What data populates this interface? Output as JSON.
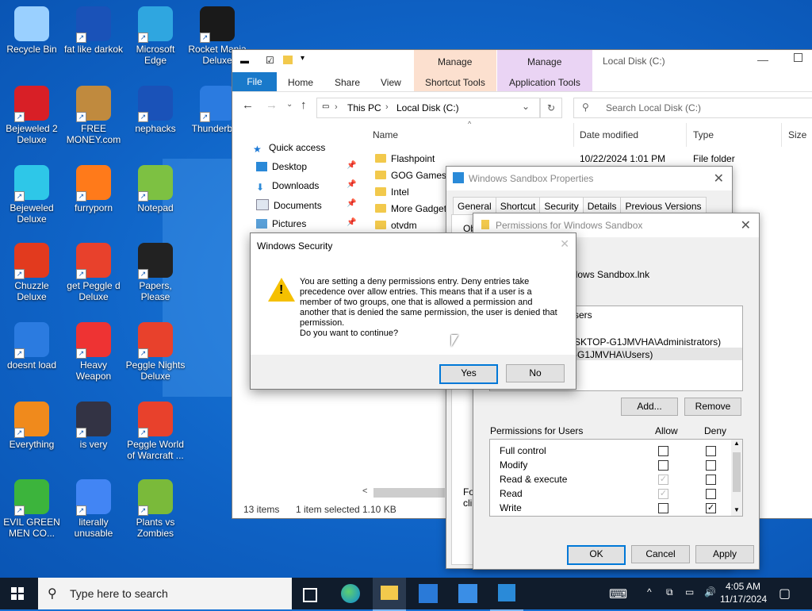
{
  "desktop_icons": [
    {
      "label": "Recycle Bin",
      "icon": "recycle-bin-icon",
      "color": "#9ad0ff"
    },
    {
      "label": "fat like darkok",
      "icon": "mpi-logo-icon",
      "color": "#1a52b8"
    },
    {
      "label": "Microsoft Edge",
      "icon": "edge-icon",
      "color": "#2fa6e0"
    },
    {
      "label": "Rocket Mania Deluxe",
      "icon": "rocket-icon",
      "color": "#1a1a1a"
    },
    {
      "label": "Bejeweled 2 Deluxe",
      "icon": "bejeweled-icon",
      "color": "#d81f26"
    },
    {
      "label": "FREE MONEY.com",
      "icon": "money-bag-icon",
      "color": "#c08a3e"
    },
    {
      "label": "nephacks",
      "icon": "mpi-logo-icon",
      "color": "#1a52b8"
    },
    {
      "label": "Thunderbird",
      "icon": "thunderbird-icon",
      "color": "#2b7be0"
    },
    {
      "label": "Bejeweled Deluxe",
      "icon": "gem-icon",
      "color": "#2ec7e8"
    },
    {
      "label": "furryporn",
      "icon": "firefox-icon",
      "color": "#ff7a1a"
    },
    {
      "label": "Notepad",
      "icon": "notepad-icon",
      "color": "#7dc142"
    },
    {
      "label": "Chuzzle Deluxe",
      "icon": "chuzzle-icon",
      "color": "#e23a1e"
    },
    {
      "label": "get Peggle d Deluxe",
      "icon": "peggle-icon",
      "color": "#e8412c"
    },
    {
      "label": "Papers, Please",
      "icon": "papers-icon",
      "color": "#222"
    },
    {
      "label": "doesnt load",
      "icon": "thunderbird-icon",
      "color": "#2b7be0"
    },
    {
      "label": "Heavy Weapon",
      "icon": "radiation-icon",
      "color": "#e33"
    },
    {
      "label": "Peggle Nights Deluxe",
      "icon": "peggle-icon",
      "color": "#e8412c"
    },
    {
      "label": "Everything",
      "icon": "search-lens-icon",
      "color": "#f08a1c"
    },
    {
      "label": "is very",
      "icon": "mpi-shield-icon",
      "color": "#334"
    },
    {
      "label": "Peggle World of Warcraft ...",
      "icon": "peggle-icon",
      "color": "#e8412c"
    },
    {
      "label": "EVIL GREEN MEN CO...",
      "icon": "msn-icon",
      "color": "#3cb43c"
    },
    {
      "label": "literally unusable",
      "icon": "chrome-icon",
      "color": "#4285f4"
    },
    {
      "label": "Plants vs Zombies",
      "icon": "pvz-icon",
      "color": "#7aba3a"
    }
  ],
  "explorer": {
    "manage1": "Manage",
    "manage2": "Manage",
    "title": "Local Disk (C:)",
    "tabs": {
      "file": "File",
      "home": "Home",
      "share": "Share",
      "view": "View",
      "shortcut_tools": "Shortcut Tools",
      "application_tools": "Application Tools"
    },
    "address": {
      "this_pc": "This PC",
      "local_disk": "Local Disk (C:)"
    },
    "search_placeholder": "Search Local Disk (C:)",
    "columns": {
      "name": "Name",
      "date": "Date modified",
      "type": "Type",
      "size": "Size"
    },
    "nav": {
      "quick_access": "Quick access",
      "desktop": "Desktop",
      "downloads": "Downloads",
      "documents": "Documents",
      "pictures": "Pictures"
    },
    "files": [
      "Flashpoint",
      "GOG Games",
      "Intel",
      "More Gadgets",
      "otvdm"
    ],
    "first_file_date": "10/22/2024 1:01 PM",
    "first_file_type": "File folder",
    "status": {
      "items": "13 items",
      "selected": "1 item selected",
      "size": "1.10 KB"
    },
    "frag_fo": "Fo",
    "frag_cli": "cli",
    "frag_ob": "Ob"
  },
  "props": {
    "title": "Windows Sandbox Properties",
    "tabs": [
      "General",
      "Shortcut",
      "Security",
      "Details",
      "Previous Versions"
    ]
  },
  "perms": {
    "title": "Permissions for Windows Sandbox",
    "object": "ndows Sandbox.lnk",
    "group_header": "sers",
    "groups": [
      "SKTOP-G1JMVHA\\Administrators)",
      "-G1JMVHA\\Users)"
    ],
    "add": "Add...",
    "remove": "Remove",
    "perm_header": "Permissions for Users",
    "allow": "Allow",
    "deny": "Deny",
    "rows": [
      {
        "name": "Full control",
        "allow": false,
        "deny": false,
        "allow_dis": false
      },
      {
        "name": "Modify",
        "allow": false,
        "deny": false,
        "allow_dis": false
      },
      {
        "name": "Read & execute",
        "allow": true,
        "deny": false,
        "allow_dis": true
      },
      {
        "name": "Read",
        "allow": true,
        "deny": false,
        "allow_dis": true
      },
      {
        "name": "Write",
        "allow": false,
        "deny": true,
        "allow_dis": false
      }
    ],
    "ok": "OK",
    "cancel": "Cancel",
    "apply": "Apply"
  },
  "security": {
    "title": "Windows Security",
    "message": "You are setting a deny permissions entry. Deny entries take precedence over allow entries. This means that if a user is a member of two groups, one that is allowed a permission and another that is denied the same permission, the user is denied that permission.",
    "question": "Do you want to continue?",
    "yes": "Yes",
    "no": "No"
  },
  "taskbar": {
    "search_placeholder": "Type here to search",
    "time": "4:05 AM",
    "date": "11/17/2024"
  }
}
